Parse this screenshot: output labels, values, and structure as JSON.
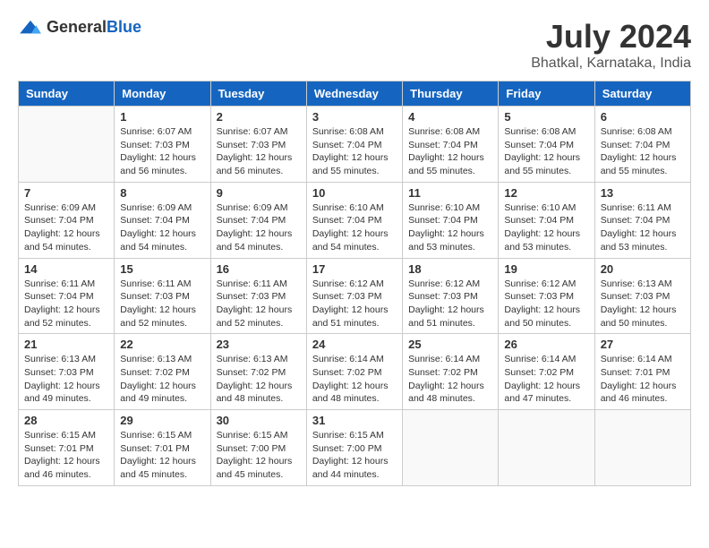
{
  "header": {
    "logo_general": "General",
    "logo_blue": "Blue",
    "month_year": "July 2024",
    "location": "Bhatkal, Karnataka, India"
  },
  "calendar": {
    "days_of_week": [
      "Sunday",
      "Monday",
      "Tuesday",
      "Wednesday",
      "Thursday",
      "Friday",
      "Saturday"
    ],
    "weeks": [
      [
        {
          "day": "",
          "sunrise": "",
          "sunset": "",
          "daylight": ""
        },
        {
          "day": "1",
          "sunrise": "Sunrise: 6:07 AM",
          "sunset": "Sunset: 7:03 PM",
          "daylight": "Daylight: 12 hours and 56 minutes."
        },
        {
          "day": "2",
          "sunrise": "Sunrise: 6:07 AM",
          "sunset": "Sunset: 7:03 PM",
          "daylight": "Daylight: 12 hours and 56 minutes."
        },
        {
          "day": "3",
          "sunrise": "Sunrise: 6:08 AM",
          "sunset": "Sunset: 7:04 PM",
          "daylight": "Daylight: 12 hours and 55 minutes."
        },
        {
          "day": "4",
          "sunrise": "Sunrise: 6:08 AM",
          "sunset": "Sunset: 7:04 PM",
          "daylight": "Daylight: 12 hours and 55 minutes."
        },
        {
          "day": "5",
          "sunrise": "Sunrise: 6:08 AM",
          "sunset": "Sunset: 7:04 PM",
          "daylight": "Daylight: 12 hours and 55 minutes."
        },
        {
          "day": "6",
          "sunrise": "Sunrise: 6:08 AM",
          "sunset": "Sunset: 7:04 PM",
          "daylight": "Daylight: 12 hours and 55 minutes."
        }
      ],
      [
        {
          "day": "7",
          "sunrise": "Sunrise: 6:09 AM",
          "sunset": "Sunset: 7:04 PM",
          "daylight": "Daylight: 12 hours and 54 minutes."
        },
        {
          "day": "8",
          "sunrise": "Sunrise: 6:09 AM",
          "sunset": "Sunset: 7:04 PM",
          "daylight": "Daylight: 12 hours and 54 minutes."
        },
        {
          "day": "9",
          "sunrise": "Sunrise: 6:09 AM",
          "sunset": "Sunset: 7:04 PM",
          "daylight": "Daylight: 12 hours and 54 minutes."
        },
        {
          "day": "10",
          "sunrise": "Sunrise: 6:10 AM",
          "sunset": "Sunset: 7:04 PM",
          "daylight": "Daylight: 12 hours and 54 minutes."
        },
        {
          "day": "11",
          "sunrise": "Sunrise: 6:10 AM",
          "sunset": "Sunset: 7:04 PM",
          "daylight": "Daylight: 12 hours and 53 minutes."
        },
        {
          "day": "12",
          "sunrise": "Sunrise: 6:10 AM",
          "sunset": "Sunset: 7:04 PM",
          "daylight": "Daylight: 12 hours and 53 minutes."
        },
        {
          "day": "13",
          "sunrise": "Sunrise: 6:11 AM",
          "sunset": "Sunset: 7:04 PM",
          "daylight": "Daylight: 12 hours and 53 minutes."
        }
      ],
      [
        {
          "day": "14",
          "sunrise": "Sunrise: 6:11 AM",
          "sunset": "Sunset: 7:04 PM",
          "daylight": "Daylight: 12 hours and 52 minutes."
        },
        {
          "day": "15",
          "sunrise": "Sunrise: 6:11 AM",
          "sunset": "Sunset: 7:03 PM",
          "daylight": "Daylight: 12 hours and 52 minutes."
        },
        {
          "day": "16",
          "sunrise": "Sunrise: 6:11 AM",
          "sunset": "Sunset: 7:03 PM",
          "daylight": "Daylight: 12 hours and 52 minutes."
        },
        {
          "day": "17",
          "sunrise": "Sunrise: 6:12 AM",
          "sunset": "Sunset: 7:03 PM",
          "daylight": "Daylight: 12 hours and 51 minutes."
        },
        {
          "day": "18",
          "sunrise": "Sunrise: 6:12 AM",
          "sunset": "Sunset: 7:03 PM",
          "daylight": "Daylight: 12 hours and 51 minutes."
        },
        {
          "day": "19",
          "sunrise": "Sunrise: 6:12 AM",
          "sunset": "Sunset: 7:03 PM",
          "daylight": "Daylight: 12 hours and 50 minutes."
        },
        {
          "day": "20",
          "sunrise": "Sunrise: 6:13 AM",
          "sunset": "Sunset: 7:03 PM",
          "daylight": "Daylight: 12 hours and 50 minutes."
        }
      ],
      [
        {
          "day": "21",
          "sunrise": "Sunrise: 6:13 AM",
          "sunset": "Sunset: 7:03 PM",
          "daylight": "Daylight: 12 hours and 49 minutes."
        },
        {
          "day": "22",
          "sunrise": "Sunrise: 6:13 AM",
          "sunset": "Sunset: 7:02 PM",
          "daylight": "Daylight: 12 hours and 49 minutes."
        },
        {
          "day": "23",
          "sunrise": "Sunrise: 6:13 AM",
          "sunset": "Sunset: 7:02 PM",
          "daylight": "Daylight: 12 hours and 48 minutes."
        },
        {
          "day": "24",
          "sunrise": "Sunrise: 6:14 AM",
          "sunset": "Sunset: 7:02 PM",
          "daylight": "Daylight: 12 hours and 48 minutes."
        },
        {
          "day": "25",
          "sunrise": "Sunrise: 6:14 AM",
          "sunset": "Sunset: 7:02 PM",
          "daylight": "Daylight: 12 hours and 48 minutes."
        },
        {
          "day": "26",
          "sunrise": "Sunrise: 6:14 AM",
          "sunset": "Sunset: 7:02 PM",
          "daylight": "Daylight: 12 hours and 47 minutes."
        },
        {
          "day": "27",
          "sunrise": "Sunrise: 6:14 AM",
          "sunset": "Sunset: 7:01 PM",
          "daylight": "Daylight: 12 hours and 46 minutes."
        }
      ],
      [
        {
          "day": "28",
          "sunrise": "Sunrise: 6:15 AM",
          "sunset": "Sunset: 7:01 PM",
          "daylight": "Daylight: 12 hours and 46 minutes."
        },
        {
          "day": "29",
          "sunrise": "Sunrise: 6:15 AM",
          "sunset": "Sunset: 7:01 PM",
          "daylight": "Daylight: 12 hours and 45 minutes."
        },
        {
          "day": "30",
          "sunrise": "Sunrise: 6:15 AM",
          "sunset": "Sunset: 7:00 PM",
          "daylight": "Daylight: 12 hours and 45 minutes."
        },
        {
          "day": "31",
          "sunrise": "Sunrise: 6:15 AM",
          "sunset": "Sunset: 7:00 PM",
          "daylight": "Daylight: 12 hours and 44 minutes."
        },
        {
          "day": "",
          "sunrise": "",
          "sunset": "",
          "daylight": ""
        },
        {
          "day": "",
          "sunrise": "",
          "sunset": "",
          "daylight": ""
        },
        {
          "day": "",
          "sunrise": "",
          "sunset": "",
          "daylight": ""
        }
      ]
    ]
  }
}
